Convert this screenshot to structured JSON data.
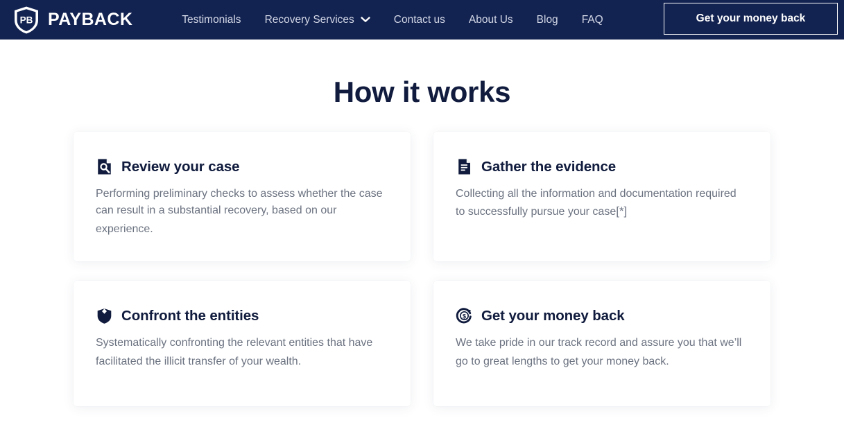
{
  "navbar": {
    "logo_icon": "shield-logo-icon",
    "logo_mark_text": "PB",
    "brand_name": "PAYBACK",
    "background_color": "#132351",
    "links": [
      {
        "label": "Testimonials",
        "has_dropdown": false
      },
      {
        "label": "Recovery Services",
        "has_dropdown": true,
        "dropdown_icon": "chevron-down-icon"
      },
      {
        "label": "Contact us",
        "has_dropdown": false
      },
      {
        "label": "About Us",
        "has_dropdown": false
      },
      {
        "label": "Blog",
        "has_dropdown": false
      },
      {
        "label": "FAQ",
        "has_dropdown": false
      }
    ],
    "cta_label": "Get your money back"
  },
  "main": {
    "title": "How it works",
    "title_color": "#101b3d",
    "cards": [
      {
        "icon": "document-search-icon",
        "title": "Review your case",
        "text": "Performing preliminary checks to assess whether the case can result in a substantial recovery, based on our experience.",
        "note": ""
      },
      {
        "icon": "document-lines-icon",
        "title": "Gather the evidence",
        "text": "Collecting all the information and documentation required to successfully pursue your case",
        "note": "[*]"
      },
      {
        "icon": "shield-icon",
        "title": "Confront the entities",
        "text": "Systematically confronting the relevant entities that have facilitated the illicit transfer of your wealth.",
        "note": ""
      },
      {
        "icon": "dollar-refresh-icon",
        "title": "Get your money back",
        "text": "We take pride in our track record and assure you that we’ll go to great lengths to get your money back.",
        "note": ""
      }
    ]
  }
}
